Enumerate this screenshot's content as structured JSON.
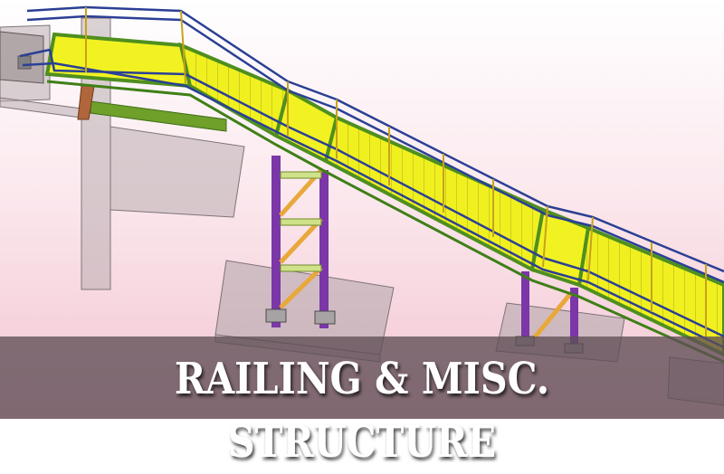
{
  "image": {
    "subject": "3D steel staircase model with railings",
    "colors": {
      "stair_fill": "#f2f21e",
      "stair_edge": "#4f8f1f",
      "railing": "#2a3f95",
      "column": "#7a35a6",
      "brace": "#e6a63a",
      "concrete": "#bcb0b4",
      "background_top": "#ffffff",
      "background_bottom": "#f4c9d5"
    }
  },
  "banner": {
    "title": "RAILING & MISC. STRUCTURE",
    "background": "#5f4e56"
  }
}
